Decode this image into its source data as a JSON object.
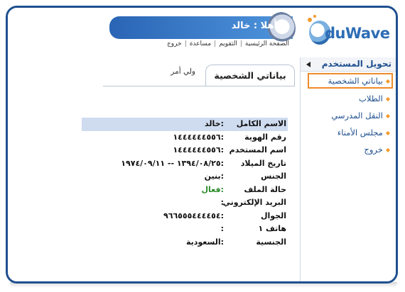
{
  "header": {
    "greeting": "أهلا : خالد",
    "logo_text": "duWave",
    "top_links": [
      {
        "label": "الصفحة الرئيسية"
      },
      {
        "label": "التقويم"
      },
      {
        "label": "مساعدة"
      },
      {
        "label": "خروج"
      }
    ]
  },
  "sidebar": {
    "title": "تحويل المستخدم",
    "items": [
      {
        "label": "بياناتي الشخصية",
        "active": true
      },
      {
        "label": "الطلاب"
      },
      {
        "label": "النقل المدرسي"
      },
      {
        "label": "مجلس الأمناء"
      },
      {
        "label": "خروج"
      }
    ]
  },
  "tabs": {
    "active": "بياناتي الشخصية",
    "inactive": "ولي أمر"
  },
  "profile": {
    "rows": [
      {
        "label": "الاسم الكامل",
        "value": ":خالد"
      },
      {
        "label": "رقم الهوية",
        "value": ":١٤٤٤٤٤٤٥٥٦"
      },
      {
        "label": "اسم المستخدم",
        "value": ":١٤٤٤٤٤٤٥٥٦"
      },
      {
        "label": "تاريخ الميلاد",
        "value": ":١٣٩٤/٠٨/٢٥ -- ١٩٧٤/٠٩/١١"
      },
      {
        "label": "الجنس",
        "value": ":بنين"
      },
      {
        "label": "حالة الملف",
        "value": ":فعال"
      },
      {
        "label": "البريد الإلكتروني",
        "value": ":"
      },
      {
        "label": "الجوال",
        "value": ":٩٦٦٥٥٥٤٤٤٤٥٤"
      },
      {
        "label": "هاتف ١",
        "value": ":"
      },
      {
        "label": "الجنسية",
        "value": ":السعودية"
      }
    ]
  },
  "colors": {
    "primary": "#2a65b5",
    "accent": "#f39a2a",
    "status_active": "#2a8a2a"
  }
}
